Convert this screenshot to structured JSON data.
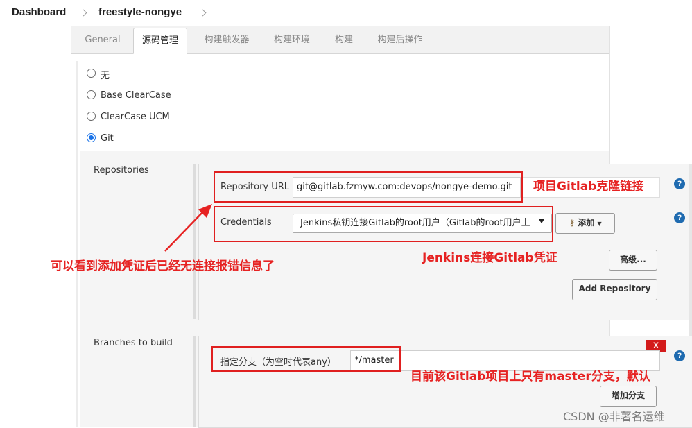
{
  "breadcrumb": {
    "home": "Dashboard",
    "project": "freestyle-nongye"
  },
  "tabs": [
    "General",
    "源码管理",
    "构建触发器",
    "构建环境",
    "构建",
    "构建后操作"
  ],
  "scm_options": [
    {
      "label": "无",
      "checked": false
    },
    {
      "label": "Base ClearCase",
      "checked": false
    },
    {
      "label": "ClearCase UCM",
      "checked": false
    },
    {
      "label": "Git",
      "checked": true
    }
  ],
  "repositories": {
    "section_label": "Repositories",
    "url_label": "Repository URL",
    "url_value": "git@gitlab.fzmyw.com:devops/nongye-demo.git",
    "credentials_label": "Credentials",
    "credentials_value": "Jenkins私钥连接Gitlab的root用户（Gitlab的root用户上",
    "add_button": "添加",
    "advanced_button": "高级...",
    "add_repo_button": "Add Repository"
  },
  "branches": {
    "section_label": "Branches to build",
    "spec_label": "指定分支（为空时代表any）",
    "spec_value": "*/master",
    "delete_button": "X",
    "add_branch_button": "增加分支"
  },
  "annotations": {
    "clone_link": "项目Gitlab克隆链接",
    "credential": "Jenkins连接Gitlab凭证",
    "no_error": "可以看到添加凭证后已经无连接报错信息了",
    "master_only": "目前该Gitlab项目上只有master分支，默认"
  },
  "watermark": "CSDN @非著名运维",
  "help_icon_text": "?",
  "colors": {
    "annotation": "#e62222",
    "help": "#1f6bb0",
    "delete": "#d31b1b",
    "radio_checked": "#1a73e8"
  }
}
